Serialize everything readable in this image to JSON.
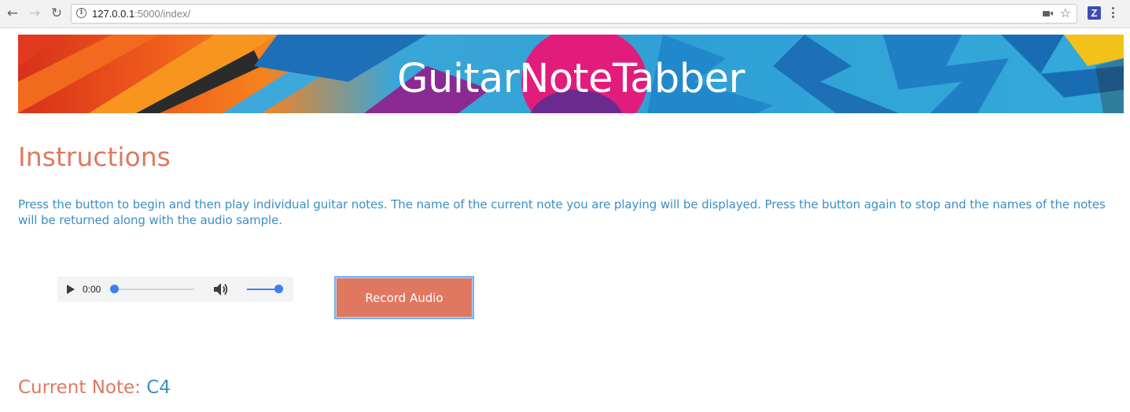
{
  "browser": {
    "url_host": "127.0.0.1",
    "url_path": ":5000/index/",
    "extension_label": "Z",
    "icons": {
      "back": "arrow-left-icon",
      "forward": "arrow-right-icon",
      "reload": "reload-icon",
      "info": "info-icon",
      "camera": "camera-icon",
      "star": "star-icon",
      "menu": "kebab-menu-icon"
    }
  },
  "banner": {
    "title": "GuitarNoteTabber"
  },
  "instructions": {
    "heading": "Instructions",
    "text": "Press the button to begin and then play individual guitar notes. The name of the current note you are playing will be displayed. Press the button again to stop and the names of the notes will be returned along with the audio sample."
  },
  "audio_player": {
    "time": "0:00",
    "progress": 0,
    "volume": 1.0
  },
  "record_button": {
    "label": "Record Audio"
  },
  "current_note": {
    "label": "Current Note:",
    "value": "C4"
  },
  "colors": {
    "accent": "#e07860",
    "text_blue": "#3b8fc4",
    "slider_blue": "#3e7ff0",
    "focus_ring": "#79aef7"
  }
}
